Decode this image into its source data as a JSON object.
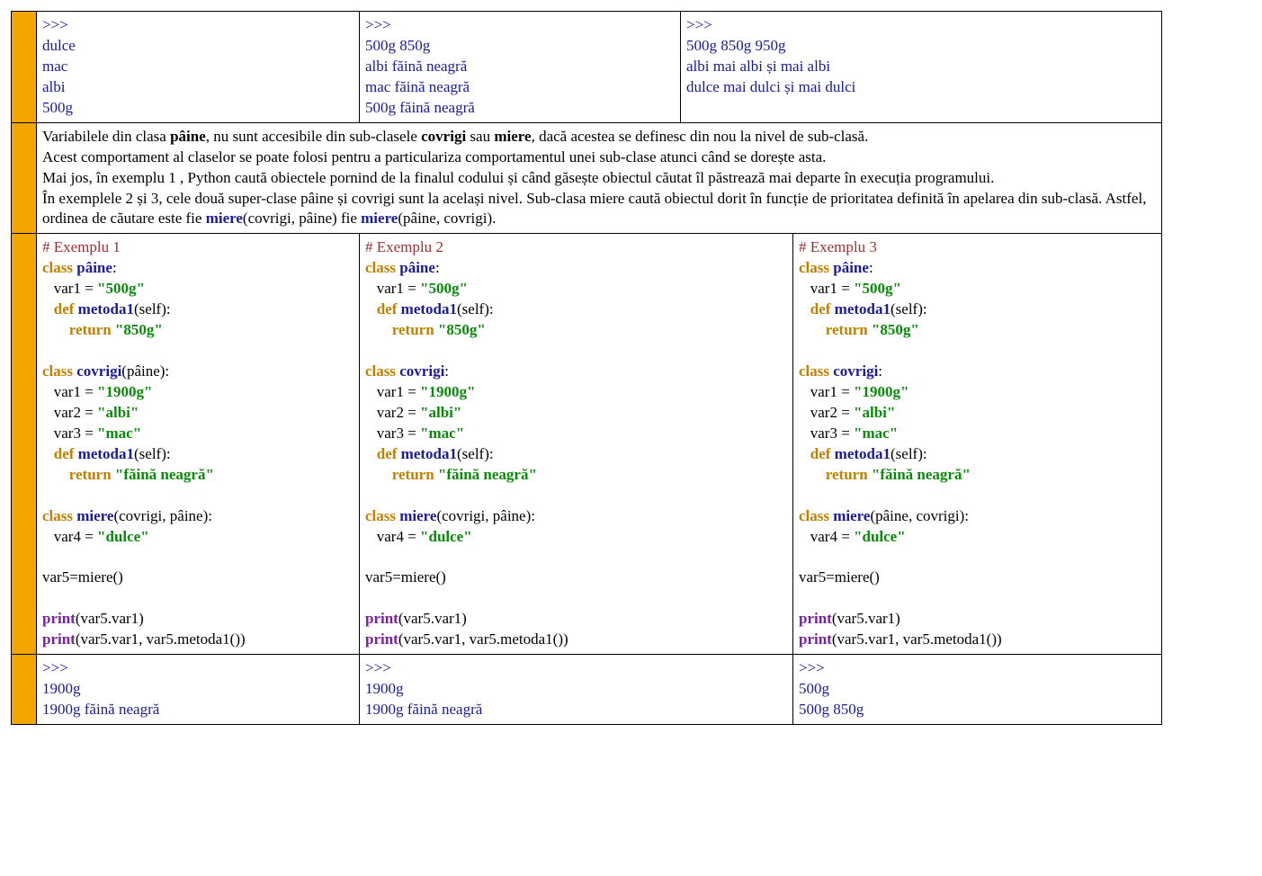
{
  "row1": {
    "a": ">>> \ndulce\nmac\nalbi\n500g",
    "b": ">>> \n500g 850g\nalbi făină neagră\nmac făină neagră\n500g făină neagră",
    "c": ">>> \n500g 850g 950g\nalbi mai albi și mai albi\ndulce mai dulci și mai dulci"
  },
  "explain": {
    "t1a": "Variabilele din clasa ",
    "b1": "pâine",
    "t1b": ", nu sunt accesibile din sub-clasele ",
    "b2": "covrigi",
    "t1c": " sau ",
    "b3": "miere",
    "t1d": ", dacă acestea se definesc din nou la nivel de sub-clasă.",
    "t2": "Acest comportament al claselor se poate folosi pentru a particulariza comportamentul unei sub-clase atunci când se dorește asta.",
    "t3": "Mai jos, în exemplu 1 , Python caută obiectele pornind de la finalul codului și când găsește obiectul căutat îl păstrează mai departe în execuția programului.",
    "t4a": "În exemplele 2 și 3, cele două super-clase pâine și covrigi sunt la același nivel. Sub-clasa miere caută obiectul dorit în funcție de prioritatea definită în apelarea din sub-clasă. Astfel, ordinea de căutare este fie ",
    "k1": "miere",
    "t4b": "(covrigi, pâine) fie ",
    "k2": "miere",
    "t4c": "(pâine, covrigi)."
  },
  "code": {
    "ex1": {
      "title": "# Exemplu 1",
      "cov_head": "(pâine):",
      "miere_head": "(covrigi, pâine):"
    },
    "ex2": {
      "title": "# Exemplu 2",
      "cov_head": ":",
      "miere_head": "(covrigi, pâine):"
    },
    "ex3": {
      "title": "# Exemplu 3",
      "cov_head": ":",
      "miere_head": "(pâine, covrigi):"
    },
    "tok": {
      "class": "class",
      "def": "def",
      "return": "return",
      "paine": "pâine",
      "covrigi": "covrigi",
      "miere": "miere",
      "metoda1": "metoda1",
      "print": "print",
      "var1": "   var1 = ",
      "var2": "   var2 = ",
      "var3": "   var3 = ",
      "var4": "   var4 = ",
      "s500": "\"500g\"",
      "s850": "\"850g\"",
      "s1900": "\"1900g\"",
      "salbi": "\"albi\"",
      "smac": "\"mac\"",
      "sfaina": "\"făină neagră\"",
      "sdulce": "\"dulce\"",
      "selfline": "(self):",
      "retind": "       ",
      "defind": "   ",
      "var5": "var5=miere()",
      "p1": "(var5.var1)",
      "p2": "(var5.var1, var5.metoda1())",
      "colon": ":"
    }
  },
  "row4": {
    "a": ">>> \n1900g\n1900g făină neagră",
    "b": ">>> \n1900g\n1900g făină neagră",
    "c": ">>> \n500g\n500g 850g"
  }
}
